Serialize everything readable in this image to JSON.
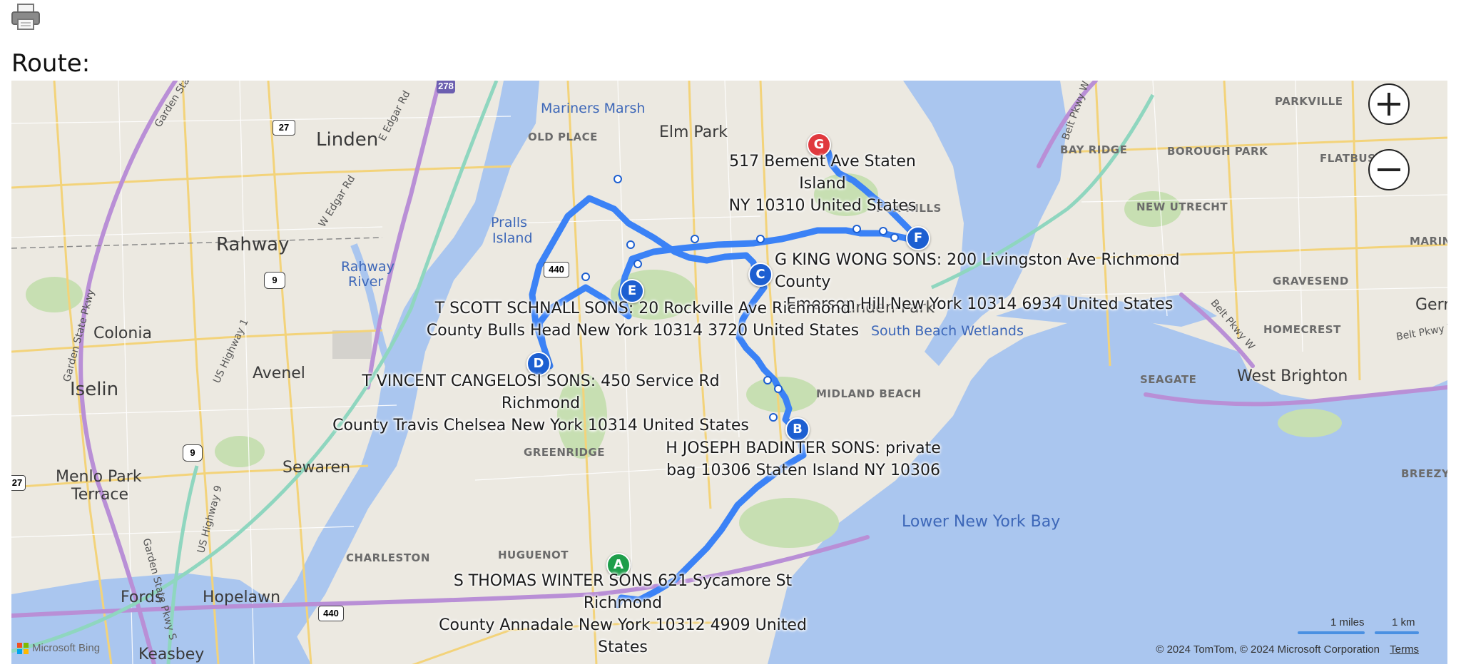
{
  "page": {
    "route_heading": "Route:",
    "print_icon": "printer-icon"
  },
  "colors": {
    "route": "#3b82f6",
    "route_dark": "#1d5fd1",
    "start_marker": "#1e9e4a",
    "end_marker": "#e0393e",
    "water": "#aac6ef",
    "land": "#ece9e1"
  },
  "map": {
    "zoom_in_icon": "plus-icon",
    "zoom_out_icon": "minus-icon",
    "places": {
      "linden": "Linden",
      "rahway": "Rahway",
      "colonia": "Colonia",
      "iselin": "Iselin",
      "avenel": "Avenel",
      "sewaren": "Sewaren",
      "menlo_park_1": "Menlo Park",
      "menlo_park_2": "Terrace",
      "fords": "Fords",
      "hopelawn": "Hopelawn",
      "keasbey": "Keasbey",
      "elm_park": "Elm Park",
      "linden_park": "Linden-Park",
      "west_brighton": "West Brighton",
      "gerr": "Gerr"
    },
    "neighborhoods": {
      "old_place": "OLD PLACE",
      "fox_hills": "FOX HILLS",
      "midland_beach": "MIDLAND BEACH",
      "greenridge": "GREENRIDGE",
      "charleston": "CHARLESTON",
      "huguenot": "HUGUENOT",
      "parkville": "PARKVILLE",
      "bay_ridge": "BAY RIDGE",
      "borough_park": "BOROUGH PARK",
      "flatbush": "FLATBUSH",
      "new_utrecht": "NEW UTRECHT",
      "gravesend": "GRAVESEND",
      "homecrest": "HOMECREST",
      "seagate": "SEAGATE",
      "breezy": "BREEZY P",
      "marin": "MARIN"
    },
    "water": {
      "mariners_marsh": "Mariners Marsh",
      "pralls_1": "Pralls",
      "pralls_2": "Island",
      "rahway_river_1": "Rahway",
      "rahway_river_2": "River",
      "south_beach": "South Beach Wetlands",
      "lower_ny_bay": "Lower New York Bay"
    },
    "roads": {
      "garden_state_1": "Garden State Pkwy",
      "garden_state_2": "Garden State Pkwy",
      "garden_state_3": "Garden State Pkwy S",
      "e_edgar": "E Edgar Rd",
      "w_edgar": "W Edgar Rd",
      "us1": "US Highway 1",
      "us9": "US Highway 9",
      "belt_1": "Belt Pkwy W",
      "belt_2": "Belt Pkwy W",
      "belt_3": "Belt Pkwy W",
      "belt_4": "Belt Pkwy"
    },
    "shields": {
      "i278": "278",
      "r27": "27",
      "r9a": "9",
      "r9b": "9",
      "r440a": "440",
      "r440b": "440",
      "r27b": "27"
    },
    "scale": {
      "miles": "1 miles",
      "km": "1 km"
    },
    "logo": "Microsoft Bing",
    "copyright": "© 2024 TomTom, © 2024 Microsoft Corporation",
    "terms": "Terms"
  },
  "stops": [
    {
      "letter": "A",
      "line1": "S THOMAS WINTER SONS 621 Sycamore St Richmond",
      "line2": "County Annadale New York 10312 4909 United States"
    },
    {
      "letter": "B",
      "line1": "H JOSEPH BADINTER SONS: private",
      "line2": "bag 10306 Staten Island NY 10306"
    },
    {
      "letter": "C",
      "line1": "G KING WONG SONS: 200 Livingston Ave Richmond County",
      "line2": "Emerson Hill New York 10314 6934 United States"
    },
    {
      "letter": "D",
      "line1": "T VINCENT CANGELOSI SONS: 450 Service Rd Richmond",
      "line2": "County Travis Chelsea New York 10314 United States"
    },
    {
      "letter": "E",
      "line1": "T SCOTT SCHNALL SONS: 20 Rockville Ave Richmond",
      "line2": "County Bulls Head New York 10314 3720 United States"
    },
    {
      "letter": "F",
      "line1": "",
      "line2": ""
    },
    {
      "letter": "G",
      "line1": "517 Bement Ave Staten Island",
      "line2": "NY 10310 United States"
    }
  ]
}
